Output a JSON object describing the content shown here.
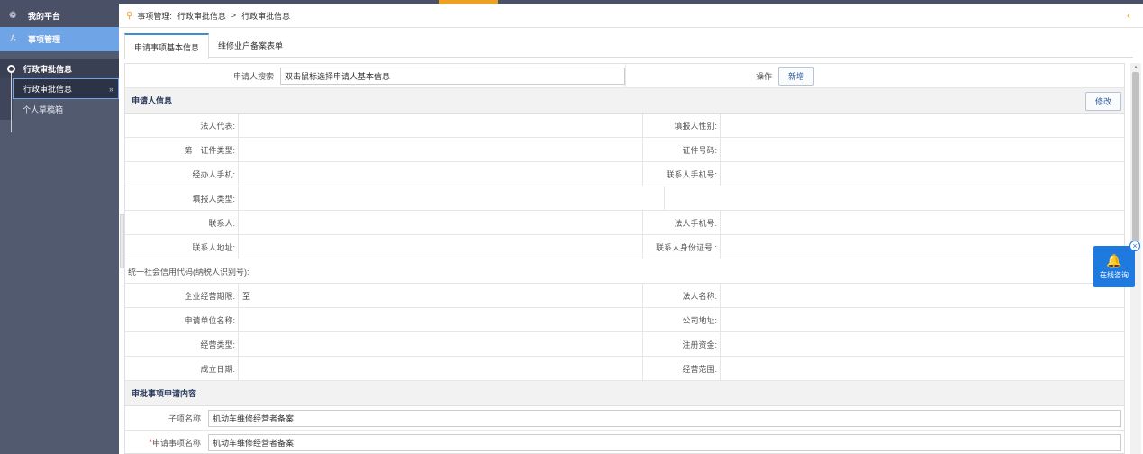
{
  "sidebar": {
    "platform": "我的平台",
    "module": "事项管理",
    "group": "行政审批信息",
    "items": [
      {
        "label": "行政审批信息",
        "arrow": "»"
      },
      {
        "label": "个人草稿箱"
      }
    ]
  },
  "breadcrumb": {
    "part1": "事项管理:",
    "part2": "行政审批信息",
    "sep": ">",
    "part3": "行政审批信息",
    "back": "‹"
  },
  "tabs": [
    "申请事项基本信息",
    "维修业户备案表单"
  ],
  "search": {
    "label": "申请人搜索",
    "value": "双击鼠标选择申请人基本信息",
    "op_label": "操作",
    "add_button": "新增"
  },
  "applicant": {
    "title": "申请人信息",
    "edit_button": "修改",
    "fields": {
      "legal_rep": "法人代表:",
      "reporter_gender": "填报人性别:",
      "id_type": "第一证件类型:",
      "id_no": "证件号码:",
      "agent_phone": "经办人手机:",
      "contact_phone": "联系人手机号:",
      "reporter_type": "填报人类型:",
      "contact": "联系人:",
      "legal_phone": "法人手机号:",
      "contact_addr": "联系人地址:",
      "contact_idcard": "联系人身份证号 :",
      "credit_code": "统一社会信用代码(纳税人识别号):",
      "biz_period": "企业经营期限:",
      "biz_period_to": "至",
      "legal_name": "法人名称:",
      "unit_name": "申请单位名称:",
      "company_addr": "公司地址:",
      "biz_type": "经营类型:",
      "reg_capital": "注册资金:",
      "found_date": "成立日期:",
      "biz_scope": "经营范围:"
    }
  },
  "approval": {
    "title": "审批事项申请内容",
    "sub_label": "子项名称",
    "sub_value": "机动车维修经营者备案",
    "req_mark": "*",
    "item_label": "申请事项名称",
    "item_value": "机动车维修经营者备案"
  },
  "chat": {
    "label": "在线咨询",
    "close": "×"
  }
}
